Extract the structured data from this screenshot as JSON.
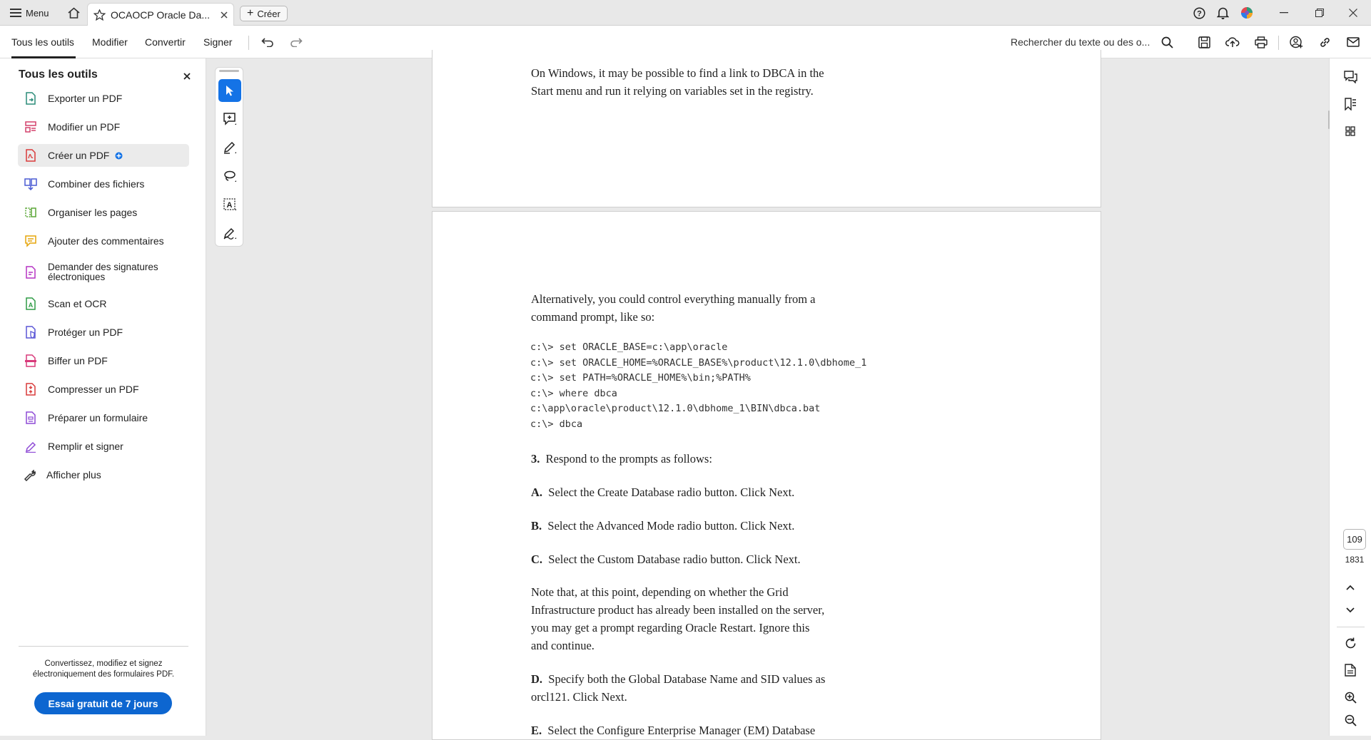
{
  "tabbar": {
    "menu_label": "Menu",
    "tab_title": "OCAOCP Oracle Da...",
    "create_label": "Créer"
  },
  "toolbar": {
    "tabs": [
      "Tous les outils",
      "Modifier",
      "Convertir",
      "Signer"
    ],
    "search_placeholder": "Rechercher du texte ou des o..."
  },
  "left_panel": {
    "title": "Tous les outils",
    "items": [
      {
        "label": "Exporter un PDF",
        "icon": "export-pdf-icon",
        "color": "#2a8c79"
      },
      {
        "label": "Modifier un PDF",
        "icon": "edit-pdf-icon",
        "color": "#d3416b"
      },
      {
        "label": "Créer un PDF",
        "icon": "create-pdf-icon",
        "color": "#d93a3a"
      },
      {
        "label": "Combiner des fichiers",
        "icon": "combine-files-icon",
        "color": "#4a5bd4"
      },
      {
        "label": "Organiser les pages",
        "icon": "organize-pages-icon",
        "color": "#5aa637"
      },
      {
        "label": "Ajouter des commentaires",
        "icon": "comment-icon",
        "color": "#e5a50a"
      },
      {
        "label": "Demander des signatures\nélectroniques",
        "icon": "request-signature-icon",
        "color": "#b634c4"
      },
      {
        "label": "Scan et OCR",
        "icon": "scan-ocr-icon",
        "color": "#2e9b45"
      },
      {
        "label": "Protéger un PDF",
        "icon": "protect-pdf-icon",
        "color": "#5b57d6"
      },
      {
        "label": "Biffer un PDF",
        "icon": "redact-pdf-icon",
        "color": "#d83a7a"
      },
      {
        "label": "Compresser un PDF",
        "icon": "compress-pdf-icon",
        "color": "#d93a3a"
      },
      {
        "label": "Préparer un formulaire",
        "icon": "prepare-form-icon",
        "color": "#8e4ad6"
      },
      {
        "label": "Remplir et signer",
        "icon": "fill-sign-icon",
        "color": "#8e4ad6"
      },
      {
        "label": "Afficher plus",
        "icon": "wrench-icon",
        "color": "#333333"
      }
    ],
    "promo_text": "Convertissez, modifiez et signez\nélectroniquement des formulaires PDF.",
    "trial_button": "Essai gratuit de 7 jours",
    "accent": "#0d66d0"
  },
  "document": {
    "page1_lines": "On Windows, it may be possible to find a link to DBCA in the\nStart menu and run it relying on variables set in the registry.",
    "p_alt": "Alternatively, you could control everything manually from a\ncommand prompt, like so:",
    "code": "c:\\> set ORACLE_BASE=c:\\app\\oracle\nc:\\> set ORACLE_HOME=%ORACLE_BASE%\\product\\12.1.0\\dbhome_1\nc:\\> set PATH=%ORACLE_HOME%\\bin;%PATH%\nc:\\> where dbca\nc:\\app\\oracle\\product\\12.1.0\\dbhome_1\\BIN\\dbca.bat\nc:\\> dbca",
    "step3_num": "3.",
    "step3_text": "Respond to the prompts as follows:",
    "stepA_num": "A.",
    "stepA_text": "Select the Create Database radio button. Click Next.",
    "stepB_num": "B.",
    "stepB_text": "Select the Advanced Mode radio button. Click Next.",
    "stepC_num": "C.",
    "stepC_text": "Select the Custom Database radio button. Click Next.",
    "note": "Note that, at this point, depending on whether the Grid\nInfrastructure product has already been installed on the server,\nyou may get a prompt regarding Oracle Restart. Ignore this\nand continue.",
    "stepD_num": "D.",
    "stepD_text": "Specify both the Global Database Name and SID values as\norcl121. Click Next.",
    "stepE_num": "E.",
    "stepE_text": "Select the Configure Enterprise Manager (EM) Database"
  },
  "right_rail": {
    "current_page": "109",
    "total_pages": "1831"
  }
}
